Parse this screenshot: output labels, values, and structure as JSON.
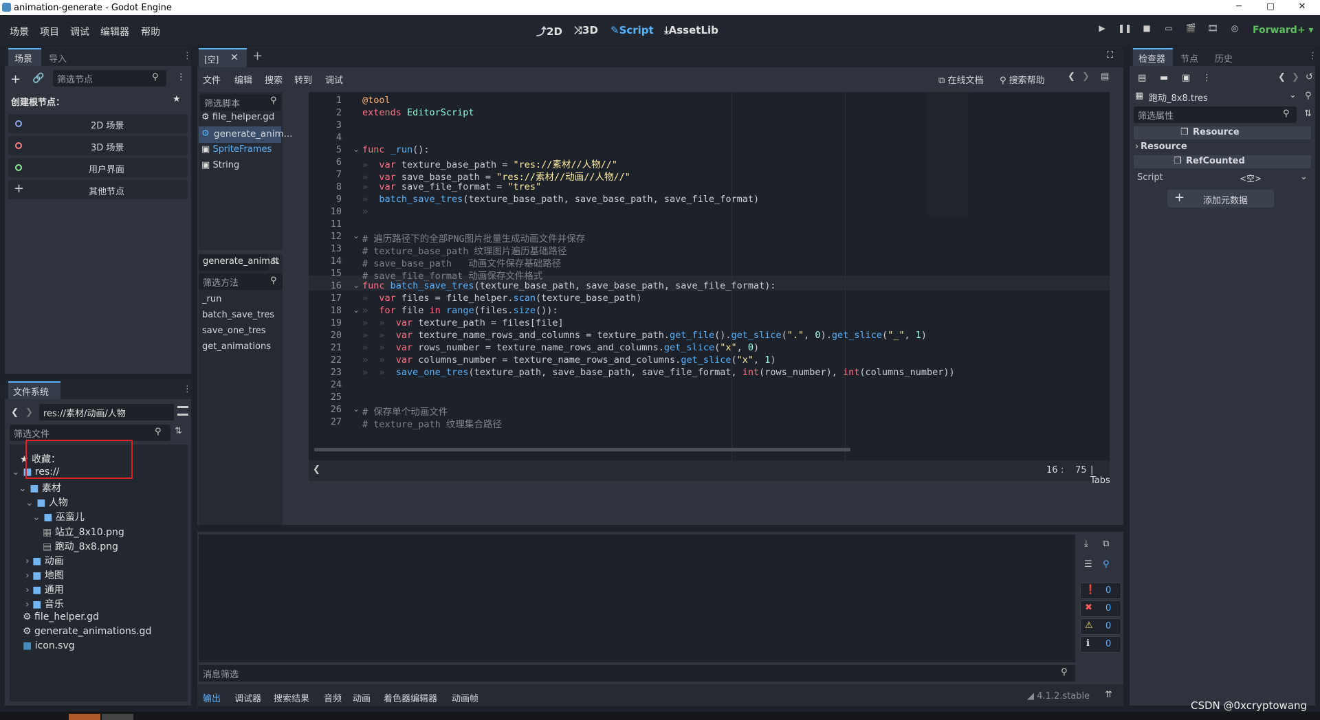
{
  "window": {
    "title": "animation-generate - Godot Engine",
    "minimize": "─",
    "maximize": "▢",
    "close": "✕"
  },
  "menu": [
    "场景",
    "项目",
    "调试",
    "编辑器",
    "帮助"
  ],
  "workspaces": {
    "2d": "2D",
    "3d": "3D",
    "script": "Script",
    "assetlib": "AssetLib"
  },
  "renderer": "Forward+",
  "scene_dock": {
    "tabs": [
      "场景",
      "导入"
    ],
    "filter_placeholder": "筛选节点",
    "create_root_label": "创建根节点：",
    "root_options": [
      "2D 场景",
      "3D 场景",
      "用户界面",
      "其他节点"
    ],
    "root_option_colors": [
      "#8da5f3",
      "#fc7f7f",
      "#8eef97",
      "#e0e0e0"
    ]
  },
  "filesystem": {
    "title": "文件系统",
    "path": "res://素材/动画/人物",
    "filter_placeholder": "筛选文件",
    "tree": [
      {
        "label": "收藏：",
        "icon": "star-icon"
      },
      {
        "label": "res://",
        "icon": "folder-icon"
      },
      {
        "label": "素材",
        "icon": "folder-icon"
      },
      {
        "label": "人物",
        "icon": "folder-icon"
      },
      {
        "label": "巫蛮儿",
        "icon": "folder-icon"
      },
      {
        "label": "站立_8x10.png",
        "icon": "image-file-icon"
      },
      {
        "label": "跑动_8x8.png",
        "icon": "image-file-icon"
      },
      {
        "label": "动画",
        "icon": "folder-icon"
      },
      {
        "label": "地图",
        "icon": "folder-icon"
      },
      {
        "label": "通用",
        "icon": "folder-icon"
      },
      {
        "label": "音乐",
        "icon": "folder-icon"
      },
      {
        "label": "file_helper.gd",
        "icon": "gear-icon"
      },
      {
        "label": "generate_animations.gd",
        "icon": "gear-icon"
      },
      {
        "label": "icon.svg",
        "icon": "svg-file-icon"
      }
    ]
  },
  "script_editor": {
    "tab": "[空]",
    "menu": [
      "文件",
      "编辑",
      "搜索",
      "转到",
      "调试"
    ],
    "online_docs": "在线文档",
    "search_help": "搜索帮助",
    "filter_scripts": "筛选脚本",
    "scripts": [
      "file_helper.gd",
      "generate_anim...",
      "SpriteFrames",
      "String"
    ],
    "current_script": "generate_animat",
    "filter_methods": "筛选方法",
    "methods": [
      "_run",
      "batch_save_tres",
      "save_one_tres",
      "get_animations"
    ],
    "status": {
      "line": "16",
      "sep": ":",
      "col": "75",
      "indent": "| Tabs"
    },
    "line_numbers": [
      "1",
      "2",
      "3",
      "4",
      "5",
      "6",
      "7",
      "8",
      "9",
      "10",
      "11",
      "12",
      "13",
      "14",
      "15",
      "16",
      "17",
      "18",
      "19",
      "20",
      "21",
      "22",
      "23",
      "24",
      "25",
      "26",
      "27"
    ],
    "code": [
      [
        [
          "at",
          "@tool"
        ]
      ],
      [
        [
          "kw",
          "extends "
        ],
        [
          "ty",
          "EditorScript"
        ]
      ],
      [],
      [],
      [
        [
          "kw",
          "func "
        ],
        [
          "fn",
          "_run"
        ],
        [
          "pl",
          "():"
        ]
      ],
      [
        [
          "tabc",
          "»  "
        ],
        [
          "kw",
          "var "
        ],
        [
          "pl",
          "texture_base_path = "
        ],
        [
          "st",
          "\"res://素材//人物//\""
        ]
      ],
      [
        [
          "tabc",
          "»  "
        ],
        [
          "kw",
          "var "
        ],
        [
          "pl",
          "save_base_path = "
        ],
        [
          "st",
          "\"res://素材//动画//人物//\""
        ]
      ],
      [
        [
          "tabc",
          "»  "
        ],
        [
          "kw",
          "var "
        ],
        [
          "pl",
          "save_file_format = "
        ],
        [
          "st",
          "\"tres\""
        ]
      ],
      [
        [
          "tabc",
          "»  "
        ],
        [
          "fn",
          "batch_save_tres"
        ],
        [
          "pl",
          "(texture_base_path, save_base_path, save_file_format)"
        ]
      ],
      [
        [
          "tabc",
          "»  "
        ]
      ],
      [],
      [
        [
          "cm",
          "# 遍历路径下的全部PNG图片批量生成动画文件并保存"
        ]
      ],
      [
        [
          "cm",
          "# texture_base_path 纹理图片遍历基础路径"
        ]
      ],
      [
        [
          "cm",
          "# save_base_path   动画文件保存基础路径"
        ]
      ],
      [
        [
          "cm",
          "# save_file_format 动画保存文件格式"
        ]
      ],
      [
        [
          "kw",
          "func "
        ],
        [
          "fn",
          "batch_save_tres"
        ],
        [
          "pl",
          "(texture_base_path, save_base_path, save_file_format):"
        ]
      ],
      [
        [
          "tabc",
          "»  "
        ],
        [
          "kw",
          "var "
        ],
        [
          "pl",
          "files = "
        ],
        [
          "pl",
          "file_helper."
        ],
        [
          "fn",
          "scan"
        ],
        [
          "pl",
          "(texture_base_path)"
        ]
      ],
      [
        [
          "tabc",
          "»  "
        ],
        [
          "kw",
          "for "
        ],
        [
          "pl",
          "file "
        ],
        [
          "kw",
          "in "
        ],
        [
          "fn",
          "range"
        ],
        [
          "pl",
          "(files."
        ],
        [
          "fn",
          "size"
        ],
        [
          "pl",
          "()):"
        ]
      ],
      [
        [
          "tabc",
          "»  »  "
        ],
        [
          "kw",
          "var "
        ],
        [
          "pl",
          "texture_path = files[file]"
        ]
      ],
      [
        [
          "tabc",
          "»  »  "
        ],
        [
          "kw",
          "var "
        ],
        [
          "pl",
          "texture_name_rows_and_columns = texture_path."
        ],
        [
          "fn",
          "get_file"
        ],
        [
          "pl",
          "()."
        ],
        [
          "fn",
          "get_slice"
        ],
        [
          "pl",
          "("
        ],
        [
          "st",
          "\".\""
        ],
        [
          "pl",
          ", "
        ],
        [
          "nu",
          "0"
        ],
        [
          "pl",
          ")."
        ],
        [
          "fn",
          "get_slice"
        ],
        [
          "pl",
          "("
        ],
        [
          "st",
          "\"_\""
        ],
        [
          "pl",
          ", "
        ],
        [
          "nu",
          "1"
        ],
        [
          "pl",
          ")"
        ]
      ],
      [
        [
          "tabc",
          "»  »  "
        ],
        [
          "kw",
          "var "
        ],
        [
          "pl",
          "rows_number = texture_name_rows_and_columns."
        ],
        [
          "fn",
          "get_slice"
        ],
        [
          "pl",
          "("
        ],
        [
          "st",
          "\"x\""
        ],
        [
          "pl",
          ", "
        ],
        [
          "nu",
          "0"
        ],
        [
          "pl",
          ")"
        ]
      ],
      [
        [
          "tabc",
          "»  »  "
        ],
        [
          "kw",
          "var "
        ],
        [
          "pl",
          "columns_number = texture_name_rows_and_columns."
        ],
        [
          "fn",
          "get_slice"
        ],
        [
          "pl",
          "("
        ],
        [
          "st",
          "\"x\""
        ],
        [
          "pl",
          ", "
        ],
        [
          "nu",
          "1"
        ],
        [
          "pl",
          ")"
        ]
      ],
      [
        [
          "tabc",
          "»  »  "
        ],
        [
          "fn",
          "save_one_tres"
        ],
        [
          "pl",
          "(texture_path, save_base_path, save_file_format, "
        ],
        [
          "bi",
          "int"
        ],
        [
          "pl",
          "(rows_number), "
        ],
        [
          "bi",
          "int"
        ],
        [
          "pl",
          "(columns_number))"
        ]
      ],
      [],
      [],
      [
        [
          "cm",
          "# 保存单个动画文件"
        ]
      ],
      [
        [
          "cm",
          "# texture_path 纹理集合路径"
        ]
      ]
    ]
  },
  "output": {
    "filter_placeholder": "消息筛选",
    "tabs": [
      "输出",
      "调试器",
      "搜索结果",
      "音频",
      "动画",
      "着色器编辑器",
      "动画帧"
    ],
    "counts": [
      "0",
      "0",
      "0",
      "0"
    ],
    "version": "4.1.2.stable"
  },
  "inspector": {
    "tabs": [
      "检查器",
      "节点",
      "历史"
    ],
    "resource_name": "跑动_8x8.tres",
    "filter_placeholder": "筛选属性",
    "section_resource": "Resource",
    "subsection_resource": "Resource",
    "section_refcounted": "RefCounted",
    "script_label": "Script",
    "script_value": "<空>",
    "add_metadata": "添加元数据"
  },
  "watermark": "CSDN @0xcryptowang"
}
